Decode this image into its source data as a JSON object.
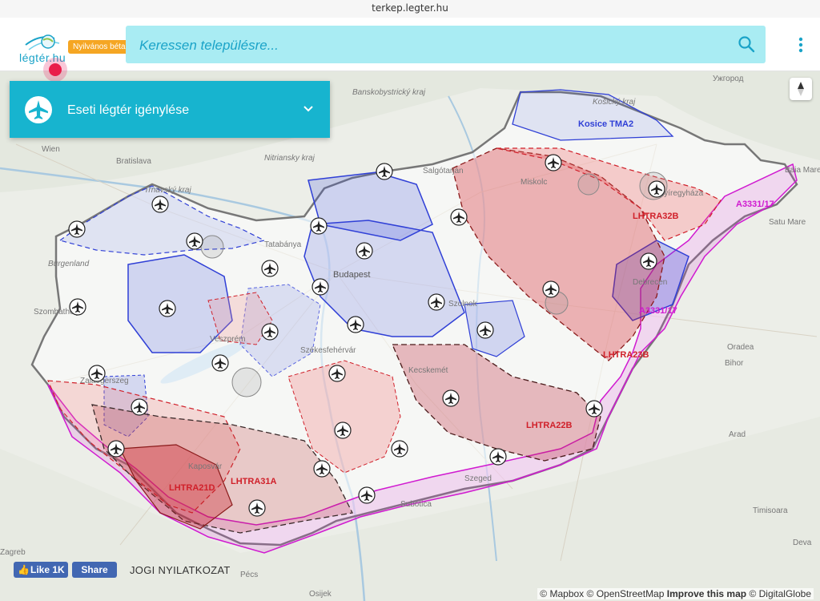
{
  "browser": {
    "url": "terkep.legter.hu"
  },
  "header": {
    "logo_text": "légtér.hu",
    "beta_badge": "Nyilvános béta",
    "search_placeholder": "Keressen településre..."
  },
  "panel": {
    "title": "Eseti légtér igénylése"
  },
  "map": {
    "places": [
      "Wien",
      "Bratislava",
      "Budapest",
      "Kecskemét",
      "Veszprém",
      "Zalaegerszeg",
      "Szombathely",
      "Salgótarján",
      "Oradea",
      "Satu Mare",
      "Bihor",
      "Arad",
      "Timisoara",
      "Subotica",
      "Osijek",
      "Szeged",
      "Burgenland",
      "Ужгород",
      "Banskobystrický kraj",
      "Nitriansky kraj",
      "Trnavský kraj",
      "Košický kraj",
      "Tatabánya",
      "Székesfehérvár",
      "Debrecen",
      "Nyíregyháza",
      "Miskolc",
      "Szolnok",
      "Pécs",
      "Kaposvár",
      "Baia Mare",
      "Deva",
      "Zagreb"
    ],
    "airspace_labels": [
      "Kosice TMA2",
      "LHTRA32B",
      "A3331/17",
      "A3331/17",
      "LHTRA23B",
      "LHTRA22B",
      "LHTRA21D",
      "LHTRA31A"
    ],
    "colors": {
      "blue": "#2f3fd6",
      "red": "#d0202a",
      "magenta": "#d01ad0",
      "dark": "#3a2a2a",
      "accent": "#17b4cf"
    }
  },
  "footer": {
    "like_label": "Like 1K",
    "share_label": "Share",
    "legal_label": "JOGI NYILATKOZAT",
    "attribution_mapbox": "© Mapbox",
    "attribution_osm": "© OpenStreetMap",
    "attribution_improve": "Improve this map",
    "attribution_dg": "© DigitalGlobe"
  }
}
